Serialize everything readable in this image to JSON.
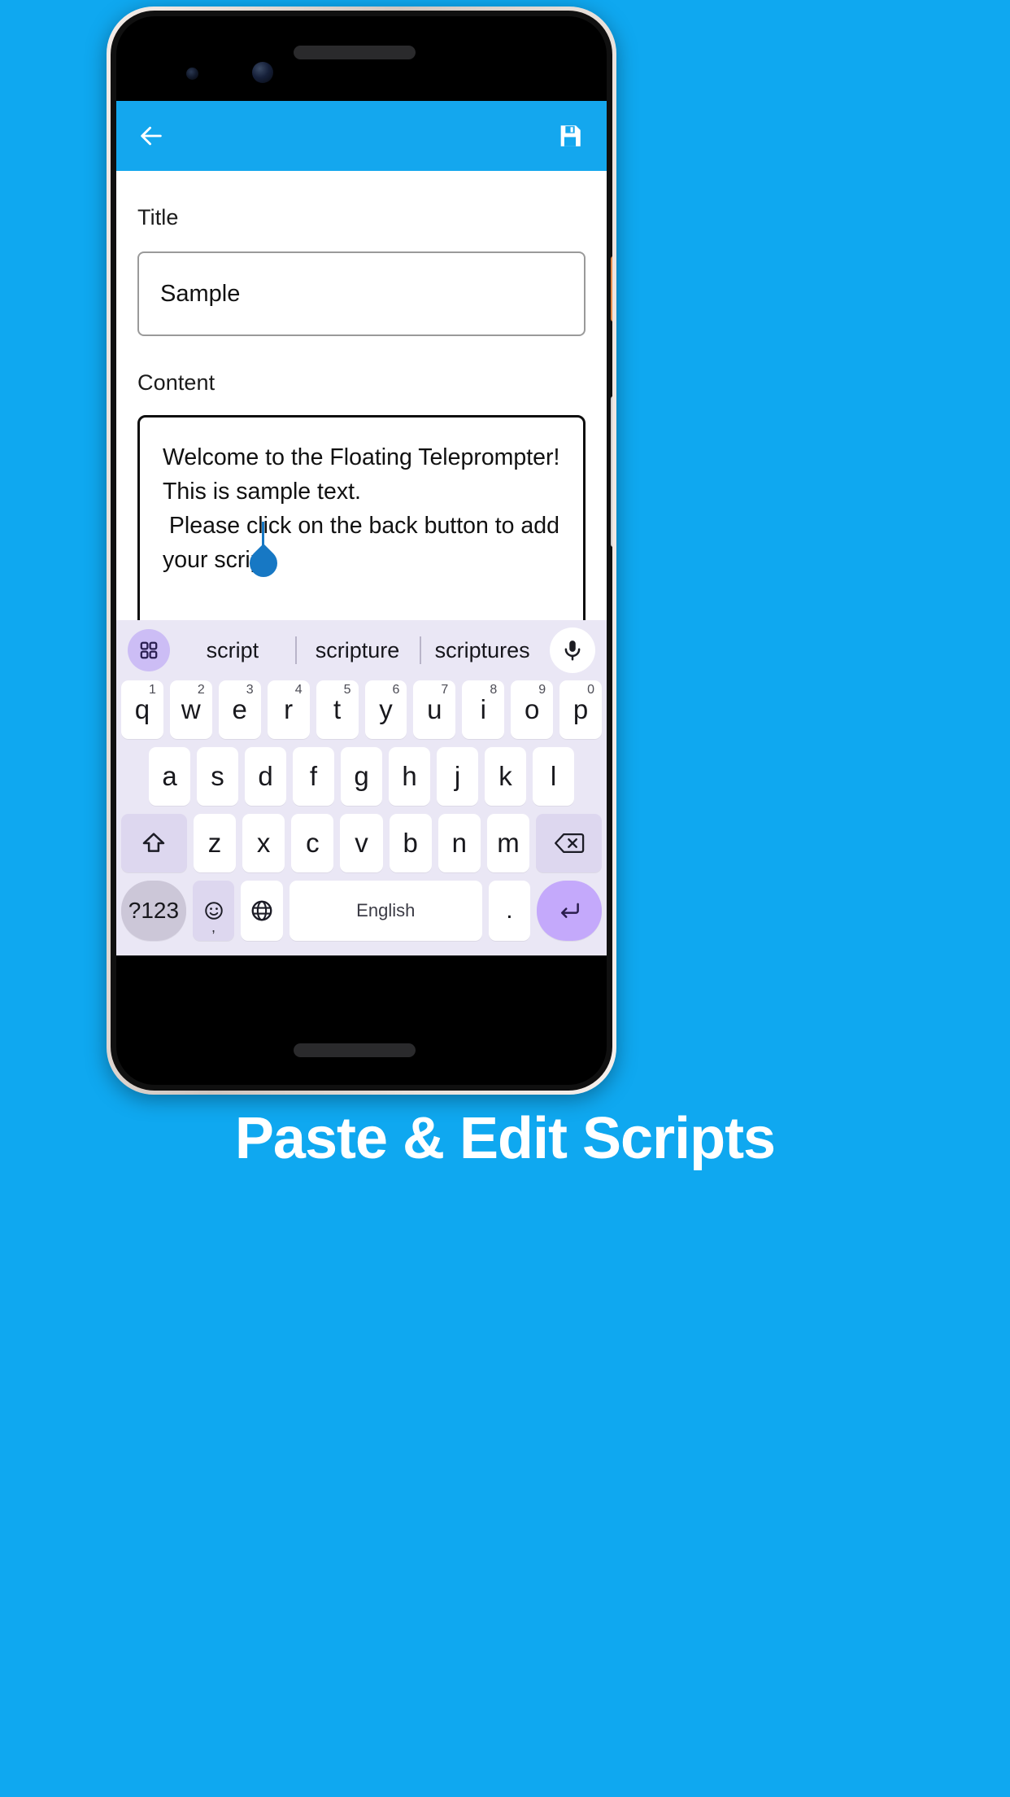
{
  "theme": {
    "background": "#0fa8f0",
    "appbar": "#14a7ee",
    "accent_cursor": "#1778c4",
    "keyboard_bg": "#eae7f5",
    "key_bg": "#ffffff",
    "key_mod_bg": "#ddd7ef",
    "enter_key_bg": "#c4a9fb",
    "suggestion_toggle_bg": "#ccbdf5"
  },
  "appbar": {
    "back_icon": "arrow-left-icon",
    "save_icon": "save-floppy-icon"
  },
  "form": {
    "title_label": "Title",
    "title_value": "Sample",
    "title_placeholder": "Title",
    "content_label": "Content",
    "content_value": "Welcome to the Floating Teleprompter!\nThis is sample text.\n Please click on the back button to add your script",
    "content_placeholder": "Content"
  },
  "keyboard": {
    "toggle_icon": "grid-four-squares-icon",
    "suggestions": [
      "script",
      "scripture",
      "scriptures"
    ],
    "mic_icon": "microphone-icon",
    "row_top": [
      {
        "letter": "q",
        "num": "1"
      },
      {
        "letter": "w",
        "num": "2"
      },
      {
        "letter": "e",
        "num": "3"
      },
      {
        "letter": "r",
        "num": "4"
      },
      {
        "letter": "t",
        "num": "5"
      },
      {
        "letter": "y",
        "num": "6"
      },
      {
        "letter": "u",
        "num": "7"
      },
      {
        "letter": "i",
        "num": "8"
      },
      {
        "letter": "o",
        "num": "9"
      },
      {
        "letter": "p",
        "num": "0"
      }
    ],
    "row_home": [
      "a",
      "s",
      "d",
      "f",
      "g",
      "h",
      "j",
      "k",
      "l"
    ],
    "row_bottom_letters": [
      "z",
      "x",
      "c",
      "v",
      "b",
      "n",
      "m"
    ],
    "shift_icon": "shift-arrow-up-icon",
    "backspace_icon": "backspace-delete-icon",
    "numeric_key_label": "?123",
    "emoji_icon": "emoji-smiley-icon",
    "emoji_sub_label": ",",
    "globe_icon": "globe-language-icon",
    "space_label": "English",
    "period_label": ".",
    "enter_icon": "enter-return-icon"
  },
  "banner": {
    "title": "Paste & Edit Scripts"
  }
}
